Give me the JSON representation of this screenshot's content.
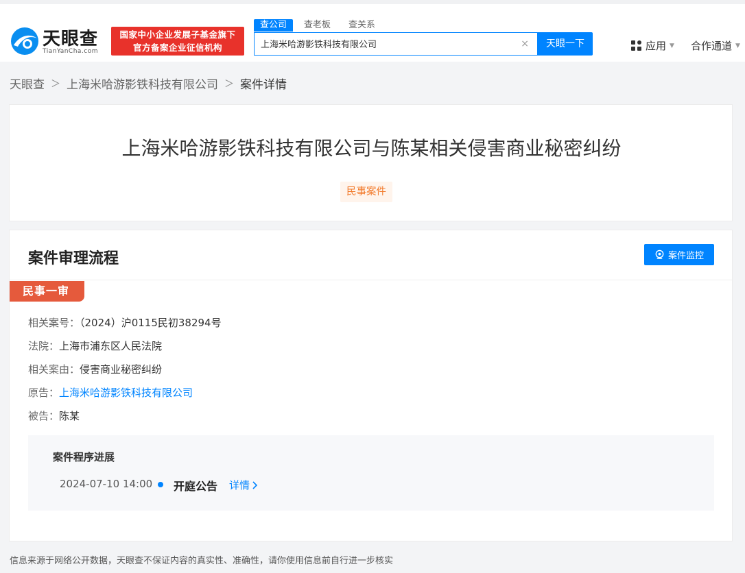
{
  "header": {
    "logo_text": "天眼查",
    "logo_sub": "TianYanCha.com",
    "badge_line1": "国家中小企业发展子基金旗下",
    "badge_line2": "官方备案企业征信机构",
    "search_tabs": [
      "查公司",
      "查老板",
      "查关系"
    ],
    "search_value": "上海米哈游影铁科技有限公司",
    "search_button": "天眼一下",
    "nav_app": "应用",
    "nav_partner": "合作通道"
  },
  "breadcrumb": {
    "home": "天眼查",
    "company": "上海米哈游影铁科技有限公司",
    "current": "案件详情"
  },
  "case": {
    "title": "上海米哈游影铁科技有限公司与陈某相关侵害商业秘密纠纷",
    "type": "民事案件"
  },
  "process": {
    "title": "案件审理流程",
    "monitor_button": "案件监控",
    "stage": "民事一审",
    "fields": {
      "case_no_label": "相关案号：",
      "case_no": "（2024）沪0115民初38294号",
      "court_label": "法院：",
      "court": "上海市浦东区人民法院",
      "cause_label": "相关案由：",
      "cause": "侵害商业秘密纠纷",
      "plaintiff_label": "原告：",
      "plaintiff": "上海米哈游影铁科技有限公司",
      "defendant_label": "被告：",
      "defendant": "陈某"
    },
    "progress": {
      "title": "案件程序进展",
      "date": "2024-07-10 14:00",
      "event": "开庭公告",
      "detail": "详情"
    }
  },
  "footer": {
    "note": "信息来源于网络公开数据，天眼查不保证内容的真实性、准确性，请你使用信息前自行进一步核实"
  },
  "colors": {
    "primary": "#0084ff",
    "badge_red": "#e8322b",
    "stage_red": "#e55a3c",
    "case_type_orange": "#f27a2b"
  }
}
